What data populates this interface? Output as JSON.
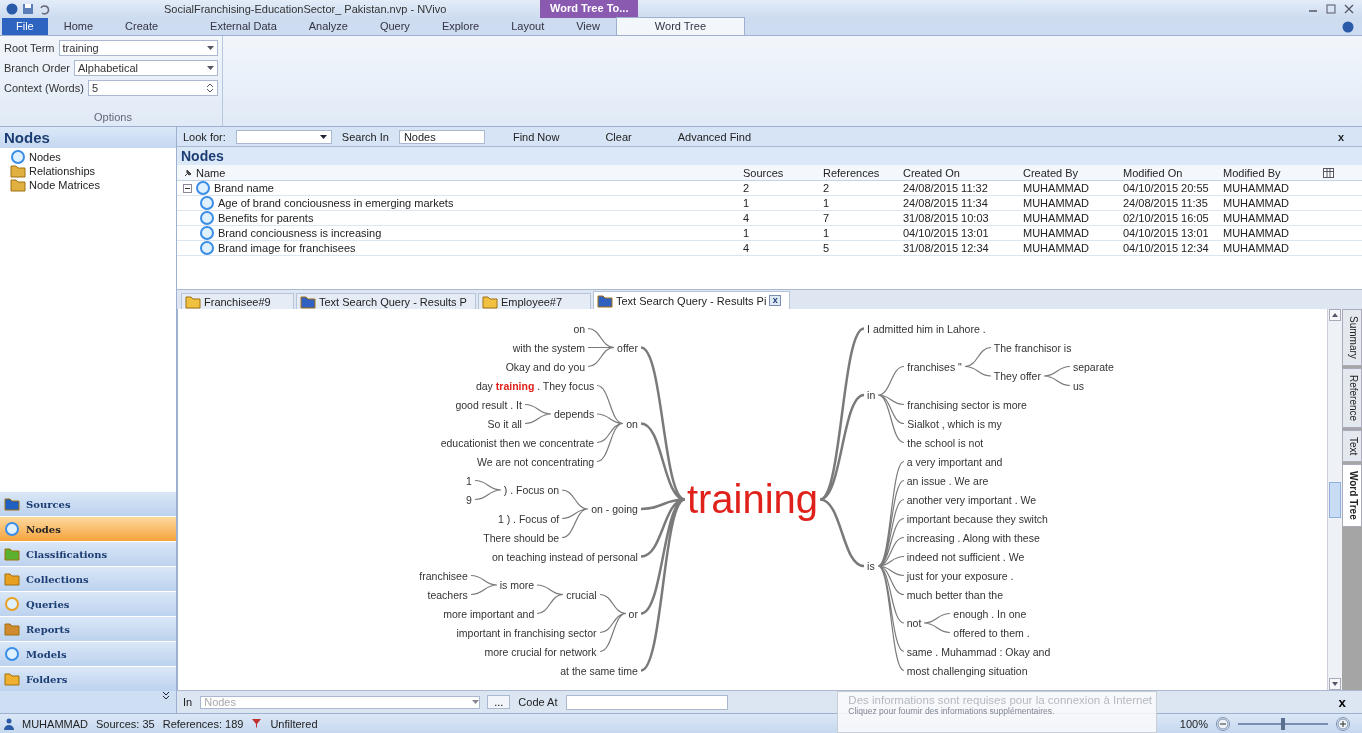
{
  "window": {
    "title": "SocialFranchising-EducationSector_ Pakistan.nvp - NVivo",
    "context_tab": "Word Tree To..."
  },
  "ribbon_tabs": [
    {
      "label": "File",
      "kind": "file",
      "selected": false
    },
    {
      "label": "Home",
      "kind": "tab",
      "selected": false
    },
    {
      "label": "Create",
      "kind": "tab",
      "selected": false
    },
    {
      "label": "External Data",
      "kind": "tab",
      "selected": false
    },
    {
      "label": "Analyze",
      "kind": "tab",
      "selected": false
    },
    {
      "label": "Query",
      "kind": "tab",
      "selected": false
    },
    {
      "label": "Explore",
      "kind": "tab",
      "selected": false
    },
    {
      "label": "Layout",
      "kind": "tab",
      "selected": false
    },
    {
      "label": "View",
      "kind": "tab",
      "selected": false
    },
    {
      "label": "Word Tree",
      "kind": "tab",
      "selected": true
    }
  ],
  "options": {
    "group_label": "Options",
    "fields": [
      {
        "label": "Root Term",
        "value": "training",
        "kind": "dropdown"
      },
      {
        "label": "Branch Order",
        "value": "Alphabetical",
        "kind": "dropdown"
      },
      {
        "label": "Context (Words)",
        "value": "5",
        "kind": "spinner"
      }
    ]
  },
  "sidebar": {
    "title": "Nodes",
    "items": [
      {
        "label": "Nodes",
        "kind": "nodes",
        "selected": false
      },
      {
        "label": "Relationships",
        "kind": "relationships",
        "selected": false
      },
      {
        "label": "Node Matrices",
        "kind": "matrices",
        "selected": false
      }
    ],
    "nav": [
      {
        "label": "Sources",
        "kind": "sources",
        "selected": false
      },
      {
        "label": "Nodes",
        "kind": "nodes",
        "selected": true
      },
      {
        "label": "Classifications",
        "kind": "classifications",
        "selected": false
      },
      {
        "label": "Collections",
        "kind": "collections",
        "selected": false
      },
      {
        "label": "Queries",
        "kind": "queries",
        "selected": false
      },
      {
        "label": "Reports",
        "kind": "reports",
        "selected": false
      },
      {
        "label": "Models",
        "kind": "models",
        "selected": false
      },
      {
        "label": "Folders",
        "kind": "folders",
        "selected": false
      }
    ]
  },
  "find_bar": {
    "look_for_label": "Look for:",
    "search_in_label": "Search In",
    "search_in_value": "Nodes",
    "buttons": [
      "Find Now",
      "Clear",
      "Advanced Find"
    ],
    "close": "x"
  },
  "nodes_table": {
    "title": "Nodes",
    "columns": [
      "Name",
      "Sources",
      "References",
      "Created On",
      "Created By",
      "Modified On",
      "Modified By"
    ],
    "rows": [
      {
        "expanded": true,
        "cells": [
          "Brand name",
          "2",
          "2",
          "24/08/2015 11:32",
          "MUHAMMAD",
          "04/10/2015 20:55",
          "MUHAMMAD"
        ],
        "children": [
          {
            "cells": [
              "Age of brand conciousness in emerging markets",
              "1",
              "1",
              "24/08/2015 11:34",
              "MUHAMMAD",
              "24/08/2015 11:35",
              "MUHAMMAD"
            ]
          },
          {
            "cells": [
              "Benefits for parents",
              "4",
              "7",
              "31/08/2015 10:03",
              "MUHAMMAD",
              "02/10/2015 16:05",
              "MUHAMMAD"
            ]
          },
          {
            "cells": [
              "Brand conciousness is increasing",
              "1",
              "1",
              "04/10/2015 13:01",
              "MUHAMMAD",
              "04/10/2015 13:01",
              "MUHAMMAD"
            ]
          },
          {
            "cells": [
              "Brand image for franchisees",
              "4",
              "5",
              "31/08/2015 12:34",
              "MUHAMMAD",
              "04/10/2015 12:34",
              "MUHAMMAD"
            ]
          }
        ]
      }
    ]
  },
  "doc_tabs": [
    {
      "label": "Franchisee#9",
      "kind": "document",
      "selected": false
    },
    {
      "label": "Text Search Query - Results P",
      "kind": "query",
      "selected": false
    },
    {
      "label": "Employee#7",
      "kind": "document",
      "selected": false
    },
    {
      "label": "Text Search Query - Results Pi",
      "kind": "query",
      "selected": true,
      "close": "x"
    }
  ],
  "word_tree": {
    "root": "training",
    "left": [
      {
        "text": "offer",
        "children": [
          {
            "text": "on"
          },
          {
            "text": "with the system"
          },
          {
            "text": "Okay and do you"
          }
        ]
      },
      {
        "text": "on",
        "children": [
          {
            "text": "day **training** . They focus"
          },
          {
            "text": "depends",
            "children": [
              {
                "text": "good result . It"
              },
              {
                "text": "So it all"
              }
            ]
          },
          {
            "text": "educationist then we concentrate"
          },
          {
            "text": "We are not concentrating"
          }
        ]
      },
      {
        "text": "on - going",
        "children": [
          {
            "text": ") . Focus on",
            "children": [
              {
                "text": "1"
              },
              {
                "text": "9"
              }
            ]
          },
          {
            "text": "1 ) . Focus of"
          },
          {
            "text": "There should be"
          }
        ]
      },
      {
        "text": "on teaching instead of personal"
      },
      {
        "text": "or",
        "children": [
          {
            "text": "crucial",
            "children": [
              {
                "text": "is more",
                "children": [
                  {
                    "text": "franchisee"
                  },
                  {
                    "text": "teachers"
                  }
                ]
              },
              {
                "text": "more important and"
              }
            ]
          },
          {
            "text": "important in franchising sector"
          },
          {
            "text": "more crucial for network"
          }
        ]
      },
      {
        "text": "at the same time"
      }
    ],
    "right": [
      {
        "text": "I admitted him in Lahore ."
      },
      {
        "text": "in",
        "children": [
          {
            "text": "franchises \"",
            "children": [
              {
                "text": "The franchisor is"
              },
              {
                "text": "They offer",
                "children": [
                  {
                    "text": "separate"
                  },
                  {
                    "text": "us"
                  }
                ]
              }
            ]
          },
          {
            "text": "franchising sector is more"
          },
          {
            "text": "Sialkot , which is my"
          },
          {
            "text": "the school is not"
          }
        ]
      },
      {
        "text": "is",
        "children": [
          {
            "text": "a very important and"
          },
          {
            "text": "an issue . We are"
          },
          {
            "text": "another very important . We"
          },
          {
            "text": "important because they switch"
          },
          {
            "text": "increasing . Along with these"
          },
          {
            "text": "indeed not sufficient . We"
          },
          {
            "text": "just for your exposure ."
          },
          {
            "text": "much better than the"
          },
          {
            "text": "not",
            "children": [
              {
                "text": "enough . In one"
              },
              {
                "text": "offered to them ."
              }
            ]
          },
          {
            "text": "same . Muhammad : Okay and"
          },
          {
            "text": "most challenging situation"
          }
        ]
      }
    ]
  },
  "side_tabs": [
    {
      "label": "Summary",
      "selected": false
    },
    {
      "label": "Reference",
      "selected": false
    },
    {
      "label": "Text",
      "selected": false
    },
    {
      "label": "Word Tree",
      "selected": true
    }
  ],
  "code_bar": {
    "in_label": "In",
    "in_placeholder": "Nodes",
    "browse": "...",
    "code_at_label": "Code At",
    "close": "x"
  },
  "notification": {
    "title": "Des informations sont requises pour la connexion à Internet",
    "subtitle": "Cliquez pour fournir des informations supplémentaires."
  },
  "zoom": {
    "reading": "100%",
    "level": 0.5
  },
  "status_bar": {
    "user": "MUHAMMAD",
    "sources": "Sources: 35",
    "references": "References: 189",
    "filter": "Unfiltered"
  }
}
